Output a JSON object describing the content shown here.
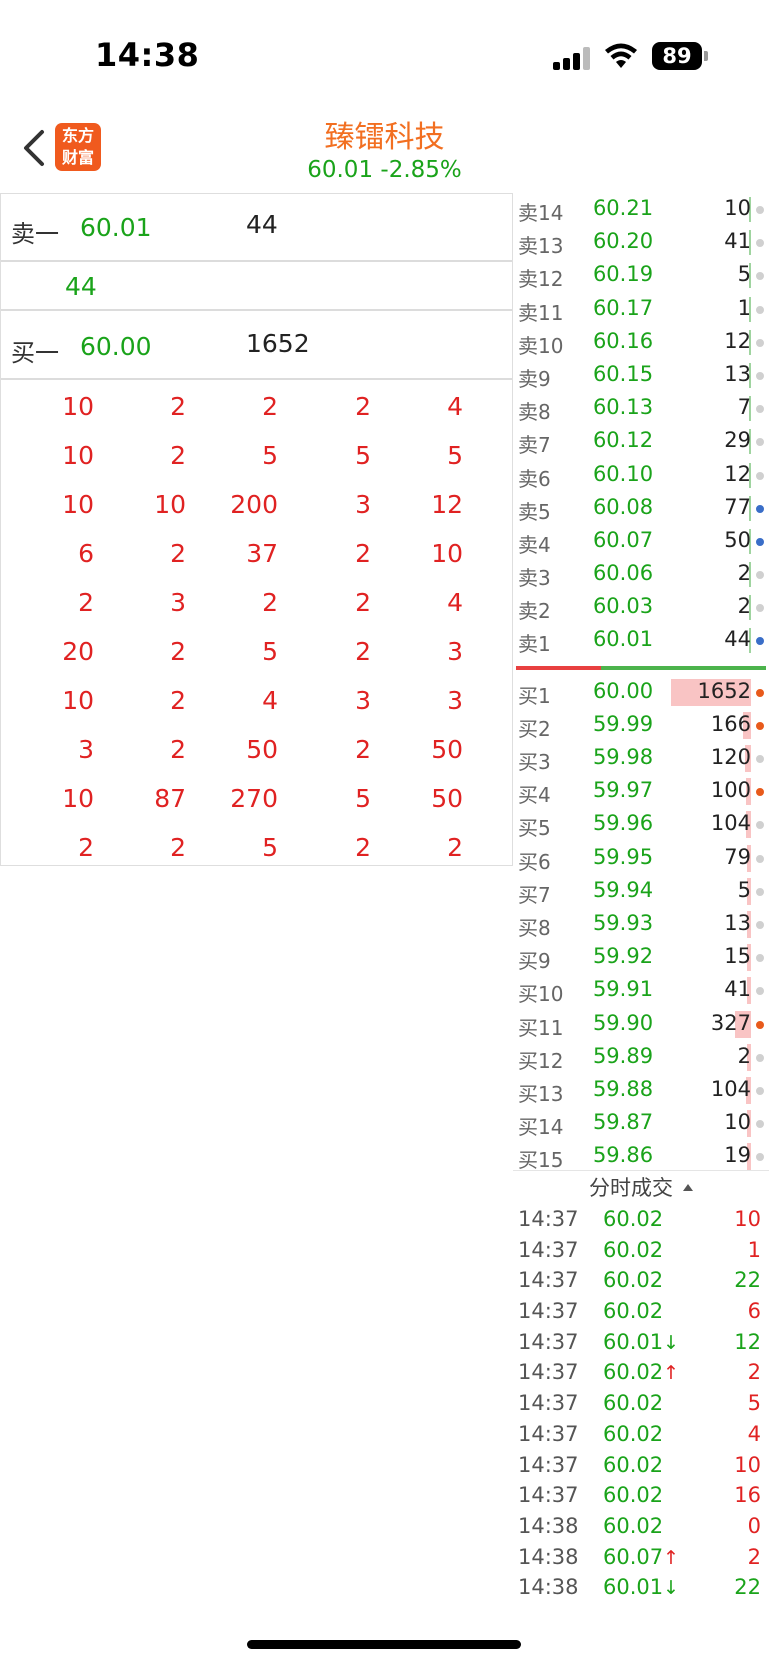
{
  "status": {
    "time": "14:38",
    "battery": "89"
  },
  "header": {
    "logo_line1": "东方",
    "logo_line2": "财富",
    "stock_name": "臻镭科技",
    "quote": "60.01  -2.85%"
  },
  "left": {
    "sell_label": "卖一",
    "sell_price": "60.01",
    "sell_vol": "44",
    "queue_vol": "44",
    "buy_label": "买一",
    "buy_price": "60.00",
    "buy_vol": "1652",
    "grid": [
      [
        "10",
        "2",
        "2",
        "2",
        "4"
      ],
      [
        "10",
        "2",
        "5",
        "5",
        "5"
      ],
      [
        "10",
        "10",
        "200",
        "3",
        "12"
      ],
      [
        "6",
        "2",
        "37",
        "2",
        "10"
      ],
      [
        "2",
        "3",
        "2",
        "2",
        "4"
      ],
      [
        "20",
        "2",
        "5",
        "2",
        "3"
      ],
      [
        "10",
        "2",
        "4",
        "3",
        "3"
      ],
      [
        "3",
        "2",
        "50",
        "2",
        "50"
      ],
      [
        "10",
        "87",
        "270",
        "5",
        "50"
      ],
      [
        "2",
        "2",
        "5",
        "2",
        "2"
      ]
    ]
  },
  "book": {
    "asks": [
      {
        "label": "卖14",
        "price": "60.21",
        "vol": "10",
        "dot": "grey"
      },
      {
        "label": "卖13",
        "price": "60.20",
        "vol": "41",
        "dot": "grey"
      },
      {
        "label": "卖12",
        "price": "60.19",
        "vol": "5",
        "dot": "grey"
      },
      {
        "label": "卖11",
        "price": "60.17",
        "vol": "1",
        "dot": "grey"
      },
      {
        "label": "卖10",
        "price": "60.16",
        "vol": "12",
        "dot": "grey"
      },
      {
        "label": "卖9",
        "price": "60.15",
        "vol": "13",
        "dot": "grey"
      },
      {
        "label": "卖8",
        "price": "60.13",
        "vol": "7",
        "dot": "grey"
      },
      {
        "label": "卖7",
        "price": "60.12",
        "vol": "29",
        "dot": "grey"
      },
      {
        "label": "卖6",
        "price": "60.10",
        "vol": "12",
        "dot": "grey"
      },
      {
        "label": "卖5",
        "price": "60.08",
        "vol": "77",
        "dot": "blue"
      },
      {
        "label": "卖4",
        "price": "60.07",
        "vol": "50",
        "dot": "blue"
      },
      {
        "label": "卖3",
        "price": "60.06",
        "vol": "2",
        "dot": "grey"
      },
      {
        "label": "卖2",
        "price": "60.03",
        "vol": "2",
        "dot": "grey"
      },
      {
        "label": "卖1",
        "price": "60.01",
        "vol": "44",
        "dot": "blue"
      }
    ],
    "bids": [
      {
        "label": "买1",
        "price": "60.00",
        "vol": "1652",
        "dot": "orange",
        "bar": 1.0
      },
      {
        "label": "买2",
        "price": "59.99",
        "vol": "166",
        "dot": "orange",
        "bar": 0.1
      },
      {
        "label": "买3",
        "price": "59.98",
        "vol": "120",
        "dot": "grey",
        "bar": 0.07
      },
      {
        "label": "买4",
        "price": "59.97",
        "vol": "100",
        "dot": "orange",
        "bar": 0.06
      },
      {
        "label": "买5",
        "price": "59.96",
        "vol": "104",
        "dot": "grey",
        "bar": 0.06
      },
      {
        "label": "买6",
        "price": "59.95",
        "vol": "79",
        "dot": "grey",
        "bar": 0.05
      },
      {
        "label": "买7",
        "price": "59.94",
        "vol": "5",
        "dot": "grey",
        "bar": 0.02
      },
      {
        "label": "买8",
        "price": "59.93",
        "vol": "13",
        "dot": "grey",
        "bar": 0.02
      },
      {
        "label": "买9",
        "price": "59.92",
        "vol": "15",
        "dot": "grey",
        "bar": 0.02
      },
      {
        "label": "买10",
        "price": "59.91",
        "vol": "41",
        "dot": "grey",
        "bar": 0.03
      },
      {
        "label": "买11",
        "price": "59.90",
        "vol": "327",
        "dot": "orange",
        "bar": 0.2
      },
      {
        "label": "买12",
        "price": "59.89",
        "vol": "2",
        "dot": "grey",
        "bar": 0.02
      },
      {
        "label": "买13",
        "price": "59.88",
        "vol": "104",
        "dot": "grey",
        "bar": 0.06
      },
      {
        "label": "买14",
        "price": "59.87",
        "vol": "10",
        "dot": "grey",
        "bar": 0.02
      },
      {
        "label": "买15",
        "price": "59.86",
        "vol": "19",
        "dot": "grey",
        "bar": 0.02
      }
    ]
  },
  "trades_header": "分时成交",
  "trades": [
    {
      "time": "14:37",
      "price": "60.02",
      "arrow": "",
      "vol": "10",
      "color": "red"
    },
    {
      "time": "14:37",
      "price": "60.02",
      "arrow": "",
      "vol": "1",
      "color": "red"
    },
    {
      "time": "14:37",
      "price": "60.02",
      "arrow": "",
      "vol": "22",
      "color": "green"
    },
    {
      "time": "14:37",
      "price": "60.02",
      "arrow": "",
      "vol": "6",
      "color": "red"
    },
    {
      "time": "14:37",
      "price": "60.01",
      "arrow": "↓",
      "vol": "12",
      "color": "green"
    },
    {
      "time": "14:37",
      "price": "60.02",
      "arrow": "↑",
      "vol": "2",
      "color": "red"
    },
    {
      "time": "14:37",
      "price": "60.02",
      "arrow": "",
      "vol": "5",
      "color": "red"
    },
    {
      "time": "14:37",
      "price": "60.02",
      "arrow": "",
      "vol": "4",
      "color": "red"
    },
    {
      "time": "14:37",
      "price": "60.02",
      "arrow": "",
      "vol": "10",
      "color": "red"
    },
    {
      "time": "14:37",
      "price": "60.02",
      "arrow": "",
      "vol": "16",
      "color": "red"
    },
    {
      "time": "14:38",
      "price": "60.02",
      "arrow": "",
      "vol": "0",
      "color": "red"
    },
    {
      "time": "14:38",
      "price": "60.07",
      "arrow": "↑",
      "vol": "2",
      "color": "red"
    },
    {
      "time": "14:38",
      "price": "60.01",
      "arrow": "↓",
      "vol": "22",
      "color": "green"
    }
  ]
}
